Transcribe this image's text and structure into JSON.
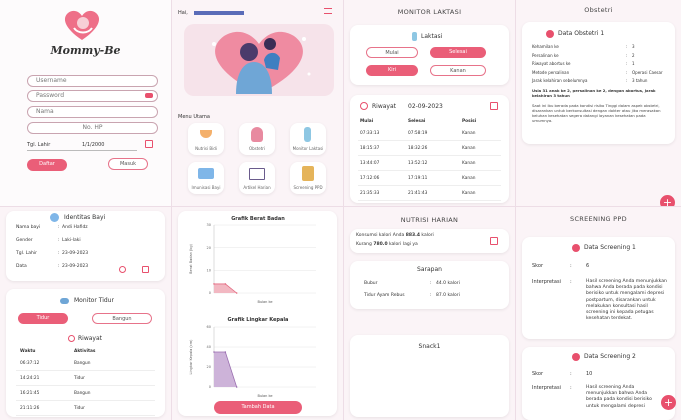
{
  "login": {
    "app_name": "Mommy-Be",
    "username_placeholder": "Username",
    "password_placeholder": "Password",
    "name_placeholder": "Nama",
    "phone_placeholder": "No. HP",
    "birth_label": "Tgl. Lahir",
    "birth_value": "1/1/2000",
    "register": "Daftar",
    "login": "Masuk"
  },
  "home": {
    "greeting": "Hai,",
    "menu_title": "Menu Utama",
    "menu": [
      "Nutrisi Bidi",
      "Obstetri",
      "Monitor Laktasi",
      "Imunisasi Bayi",
      "Artikel Harian",
      "Screening PPD"
    ]
  },
  "laktasi": {
    "title": "MONITOR LAKTASI",
    "card_title": "Laktasi",
    "mulai": "Mulai",
    "selesai": "Selesai",
    "kiri": "Kiri",
    "kanan": "Kanan",
    "history_title": "Riwayat",
    "history_date": "02-09-2023",
    "cols": [
      "Mulai",
      "Selesai",
      "Posisi"
    ],
    "rows": [
      [
        "07:33:13",
        "07:58:19",
        "Kanan"
      ],
      [
        "18:15:37",
        "18:32:26",
        "Kanan"
      ],
      [
        "13:44:07",
        "13:52:12",
        "Kanan"
      ],
      [
        "17:12:06",
        "17:19:11",
        "Kanan"
      ],
      [
        "21:35:33",
        "21:41:43",
        "Kanan"
      ]
    ]
  },
  "obstetri": {
    "title": "Obstetri",
    "card_title": "Data Obstetri 1",
    "rows": [
      [
        "Kehamilan ke",
        "3"
      ],
      [
        "Persalinan ke",
        "2"
      ],
      [
        "Riwayat abortus ke",
        "1"
      ],
      [
        "Metode persalinan",
        "Operasi Caesar"
      ],
      [
        "Jarak kelahiran sebelumnya",
        "3 tahun"
      ]
    ],
    "summary": "Usia 31 anak ke 2, persalinan ke 2, dengan abortus, jarak kelahiran 3 tahun",
    "risk_text": "Saat ini ibu berada pada kondisi risiko Tinggi dalam aspek obstetri, disarankan untuk berkonsultasi dengan dokter atau jika merasakan keluhan kesehatan segera datangi layanan kesehatan pada umumnya."
  },
  "identitas": {
    "title": "Identitas Bayi",
    "rows": [
      [
        "Nama bayi",
        "Andi Hafidz"
      ],
      [
        "Gender",
        "Laki-laki"
      ],
      [
        "Tgl. Lahir",
        "23-09-2023"
      ],
      [
        "Data",
        "23-09-2023"
      ]
    ]
  },
  "tidur": {
    "title": "Monitor Tidur",
    "tidur": "Tidur",
    "bangun": "Bangun",
    "history_title": "Riwayat",
    "cols": [
      "Waktu",
      "Aktivitas"
    ],
    "rows": [
      [
        "06:37:12",
        "Bangun"
      ],
      [
        "14:24:21",
        "Tidur"
      ],
      [
        "16:21:45",
        "Bangun"
      ],
      [
        "21:11:26",
        "Tidur"
      ]
    ]
  },
  "grafik": {
    "bb_title": "Grafik Berat Badan",
    "bb_ylabel": "Berat Badan (kg)",
    "bb_xlabel": "Bulan ke",
    "lk_title": "Grafik Lingkar Kepala",
    "lk_ylabel": "Lingkar Kepala (cm)",
    "lk_xlabel": "Bulan ke",
    "add_button": "Tambah Data"
  },
  "nutrisi": {
    "title": "NUTRISI HARIAN",
    "consumed_prefix": "Konsumsi kalori Anda",
    "consumed_value": "883.4",
    "consumed_unit": "kalori",
    "remaining_prefix": "Kurang",
    "remaining_value": "780.0",
    "remaining_suffix": "kalori lagi ya",
    "sarapan_title": "Sarapan",
    "sarapan_items": [
      [
        "Bubur",
        "44.0 kalori"
      ],
      [
        "Tidur Ayam Rebus",
        "87.0 kalori"
      ]
    ],
    "snack_title": "Snack1"
  },
  "screening": {
    "title": "SCREENING PPD",
    "card1_title": "Data Screening 1",
    "card1_skor_label": "Skor",
    "card1_skor": "6",
    "card1_interp_label": "Interpretasi",
    "card1_interp": "Hasil screening Anda menunjukkan bahwa Anda berada pada kondisi berisiko untuk mengalami depresi postpartum, disarankan untuk melakukan konsultasi hasil screening ini kepada petugas kesehatan terdekat.",
    "card2_title": "Data Screening 2",
    "card2_skor_label": "Skor",
    "card2_skor": "10",
    "card2_interp_label": "Interpretasi",
    "card2_interp": "Hasil screening Anda menunjukkan bahwa Anda berada pada kondisi berisiko untuk mengalami depresi"
  },
  "chart_data": [
    {
      "type": "area",
      "title": "Grafik Berat Badan",
      "xlabel": "Bulan ke",
      "ylabel": "Berat Badan (kg)",
      "ylim": [
        0,
        30
      ],
      "yticks": [
        0,
        10,
        20,
        30
      ],
      "x": [
        0,
        1,
        2
      ],
      "values": [
        4,
        4,
        0
      ]
    },
    {
      "type": "area",
      "title": "Grafik Lingkar Kepala",
      "xlabel": "Bulan ke",
      "ylabel": "Lingkar Kepala (cm)",
      "ylim": [
        0,
        60
      ],
      "yticks": [
        0,
        20,
        40,
        60
      ],
      "x": [
        0,
        1,
        2
      ],
      "values": [
        35,
        35,
        0
      ]
    }
  ]
}
